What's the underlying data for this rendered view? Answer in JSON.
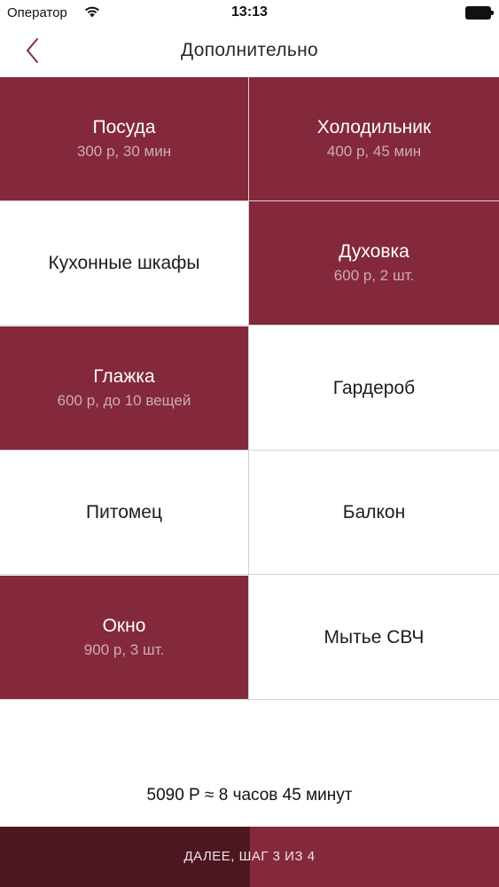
{
  "status_bar": {
    "carrier": "Оператор",
    "time": "13:13"
  },
  "nav": {
    "title": "Дополнительно"
  },
  "colors": {
    "accent": "#84293b",
    "accent_dark": "#4d1722"
  },
  "options": [
    {
      "name": "Посуда",
      "detail": "300 р, 30 мин",
      "selected": true
    },
    {
      "name": "Холодильник",
      "detail": "400 р, 45 мин",
      "selected": true
    },
    {
      "name": "Кухонные шкафы",
      "selected": false
    },
    {
      "name": "Духовка",
      "detail": "600 р, 2 шт.",
      "selected": true
    },
    {
      "name": "Глажка",
      "detail": "600 р, до 10 вещей",
      "selected": true
    },
    {
      "name": "Гардероб",
      "selected": false
    },
    {
      "name": "Питомец",
      "selected": false
    },
    {
      "name": "Балкон",
      "selected": false
    },
    {
      "name": "Окно",
      "detail": "900 р, 3 шт.",
      "selected": true
    },
    {
      "name": "Мытье СВЧ",
      "selected": false
    }
  ],
  "summary": "5090 Р ≈ 8 часов 45 минут",
  "next_button": {
    "label": "ДАЛЕЕ, ШАГ 3 ИЗ 4",
    "progress": 0.5
  }
}
